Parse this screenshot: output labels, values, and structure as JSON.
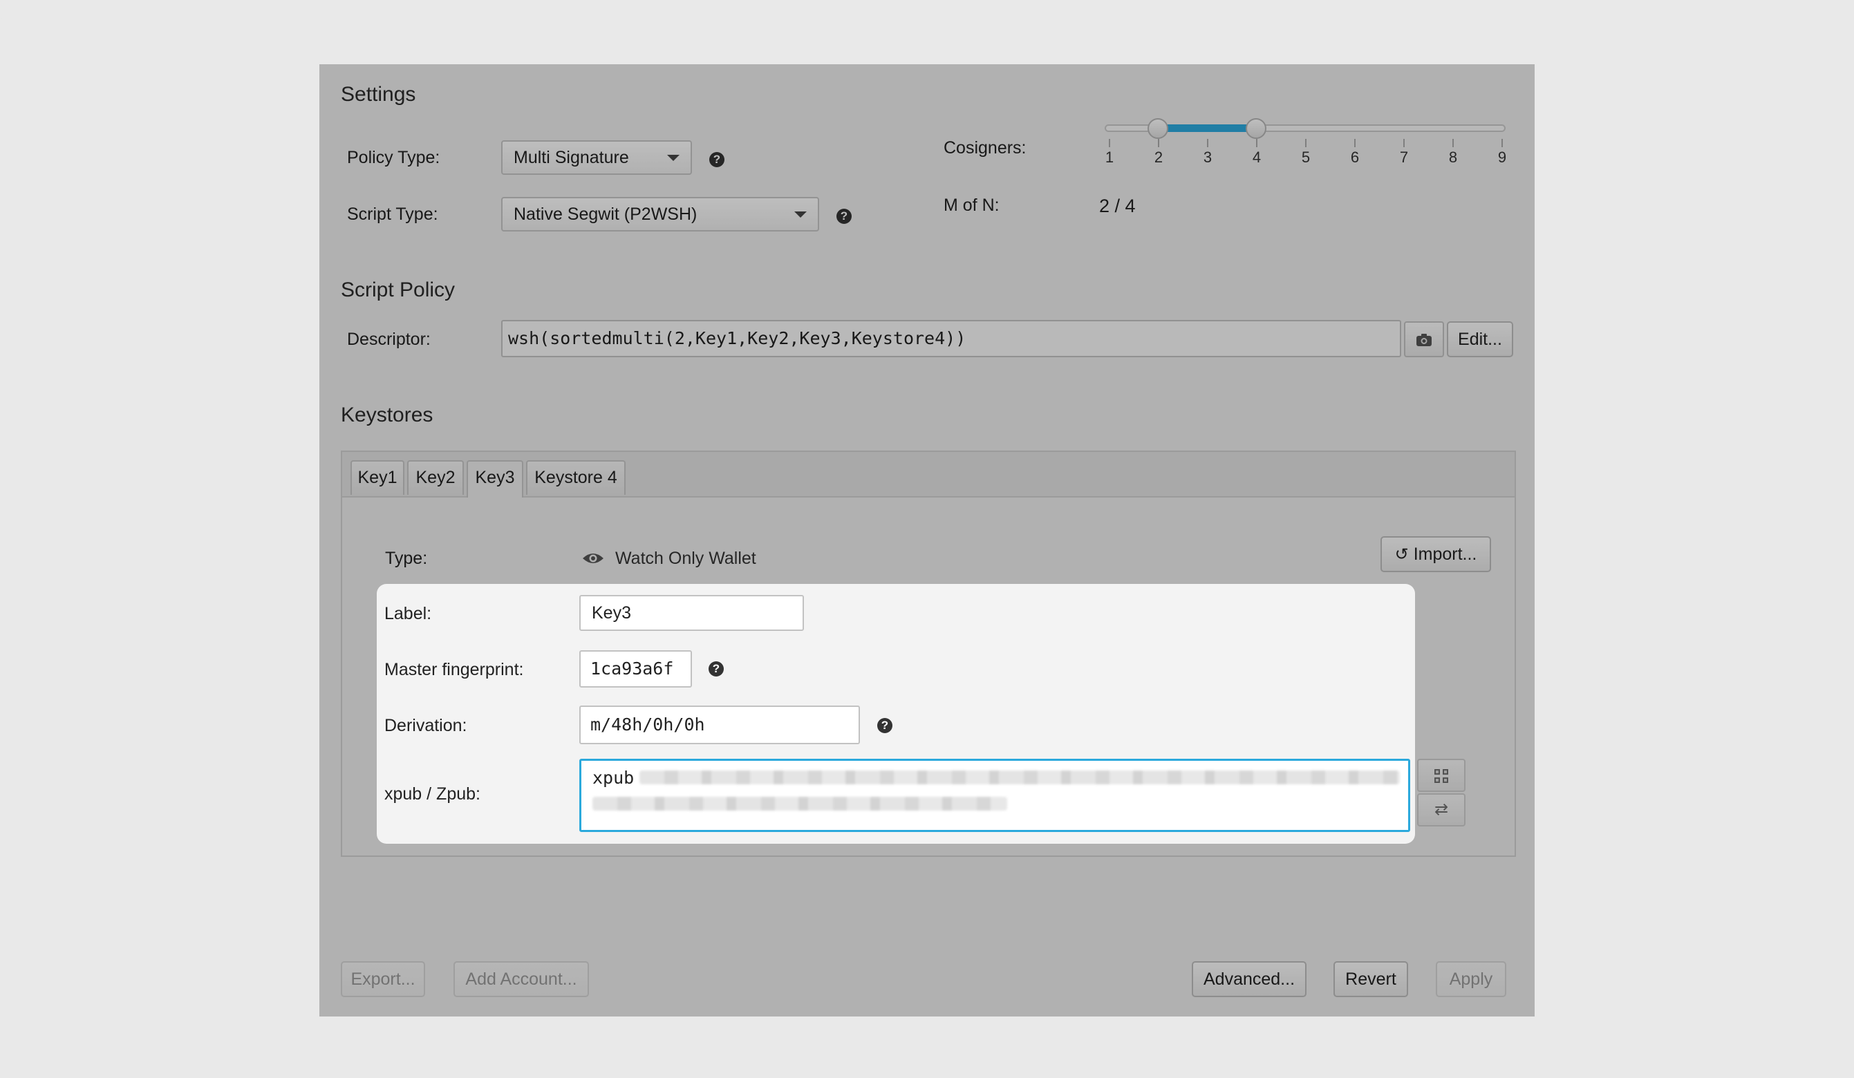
{
  "settings": {
    "title": "Settings",
    "policy_type_label": "Policy Type:",
    "policy_type_value": "Multi Signature",
    "script_type_label": "Script Type:",
    "script_type_value": "Native Segwit (P2WSH)",
    "cosigners_label": "Cosigners:",
    "cosigner_ticks": [
      "1",
      "2",
      "3",
      "4",
      "5",
      "6",
      "7",
      "8",
      "9"
    ],
    "m_of_n_label": "M of N:",
    "m_of_n_value": "2 / 4",
    "m": 2,
    "n": 4
  },
  "script_policy": {
    "title": "Script Policy",
    "descriptor_label": "Descriptor:",
    "descriptor_value": "wsh(sortedmulti(2,Key1,Key2,Key3,Keystore4))",
    "edit_label": "Edit..."
  },
  "keystores": {
    "title": "Keystores",
    "tabs": [
      "Key1",
      "Key2",
      "Key3",
      "Keystore 4"
    ],
    "active_tab": "Key3",
    "type_label": "Type:",
    "type_value": "Watch Only Wallet",
    "import_label": "Import...",
    "label_label": "Label:",
    "label_value": "Key3",
    "fingerprint_label": "Master fingerprint:",
    "fingerprint_value": "1ca93a6f",
    "derivation_label": "Derivation:",
    "derivation_value": "m/48h/0h/0h",
    "xpub_label": "xpub / Zpub:",
    "xpub_prefix": "xpub"
  },
  "footer": {
    "export_label": "Export...",
    "add_account_label": "Add Account...",
    "advanced_label": "Advanced...",
    "revert_label": "Revert",
    "apply_label": "Apply"
  },
  "colors": {
    "accent": "#2ba9dc",
    "background": "#e9e9e9"
  }
}
